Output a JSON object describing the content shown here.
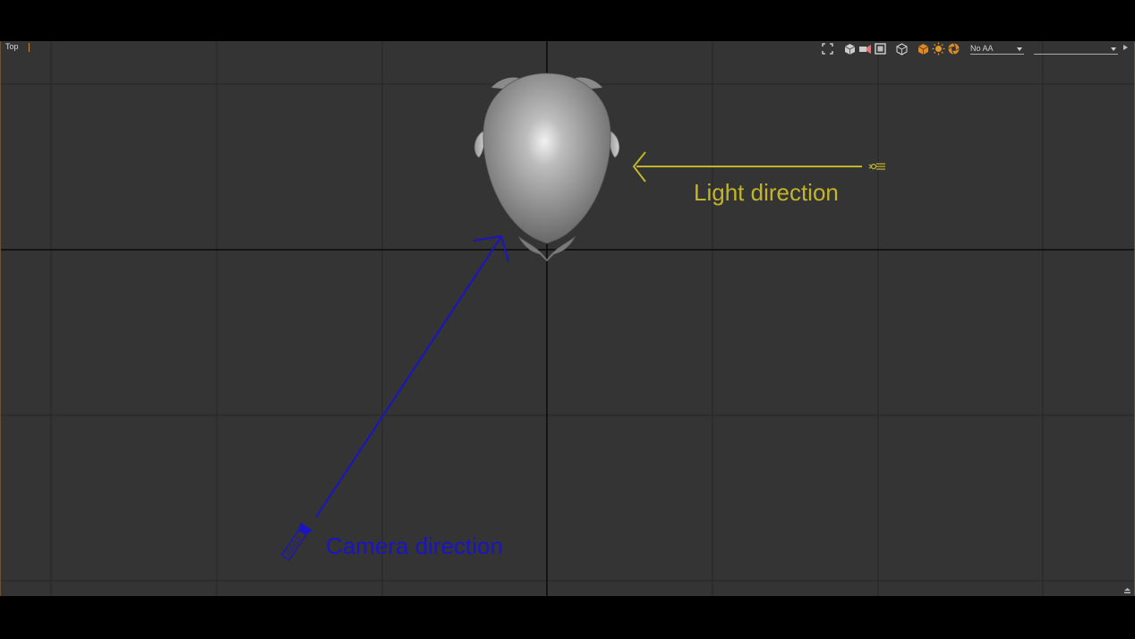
{
  "viewport": {
    "label": "Top"
  },
  "toolbar": {
    "icons": [
      "maximize-viewport-icon",
      "view-cube-icon",
      "camera-path-icon",
      "frame-all-icon",
      "shading-mode-icon",
      "render-preview-icon",
      "light-bulb-icon",
      "aperture-icon"
    ],
    "antialias_value": "No AA",
    "second_select_value": ""
  },
  "annotations": {
    "light_direction": "Light direction",
    "camera_direction": "Camera direction"
  },
  "colors": {
    "viewport_bg": "#343434",
    "grid_line": "#262626",
    "axis_line": "#0a0a0a",
    "light_annotation": "#c2b52a",
    "camera_annotation": "#1a14c4",
    "accent_orange": "#d98a2b"
  }
}
